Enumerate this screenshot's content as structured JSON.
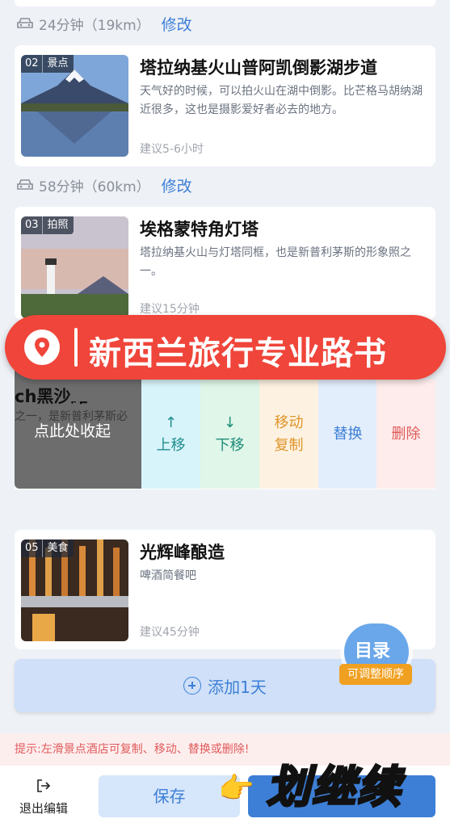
{
  "route1": {
    "time": "24分钟（19km）",
    "edit": "修改"
  },
  "route2": {
    "time": "58分钟（60km）",
    "edit": "修改"
  },
  "items": [
    {
      "num": "02",
      "cat": "景点",
      "title": "塔拉纳基火山普阿凯倒影湖步道",
      "desc": "天气好的时候，可以拍火山在湖中倒影。比芒格马胡纳湖近很多，这也是摄影爱好者必去的地方。",
      "suggest": "建议5-6小时"
    },
    {
      "num": "03",
      "cat": "拍照",
      "title": "埃格蒙特角灯塔",
      "desc": "塔拉纳基火山与灯塔同框，也是新普利茅斯的形象照之一。",
      "suggest": "建议15分钟"
    },
    {
      "num": "05",
      "cat": "美食",
      "title": "光辉峰酿造",
      "desc": "啤酒简餐吧",
      "suggest": "建议45分钟"
    }
  ],
  "banner": "新西兰旅行专业路书",
  "row04": {
    "peek_title": "ch黑沙滩",
    "peek_desc": "之一，是新普利茅斯必",
    "collapse": "点此处收起"
  },
  "actions": {
    "up": "上移",
    "down": "下移",
    "move": "移动",
    "copy": "复制",
    "replace": "替换",
    "delete": "删除"
  },
  "add_day": "添加1天",
  "toc": {
    "title": "目录",
    "badge": "可调整顺序"
  },
  "tip": "提示:左滑景点酒店可复制、移动、替换或删除!",
  "bottom": {
    "exit": "退出编辑",
    "save": "保存"
  },
  "overlay": "划继续",
  "colors": {
    "accent": "#3d7fd6",
    "banner": "#f0453a",
    "tip": "#e05a5a"
  }
}
